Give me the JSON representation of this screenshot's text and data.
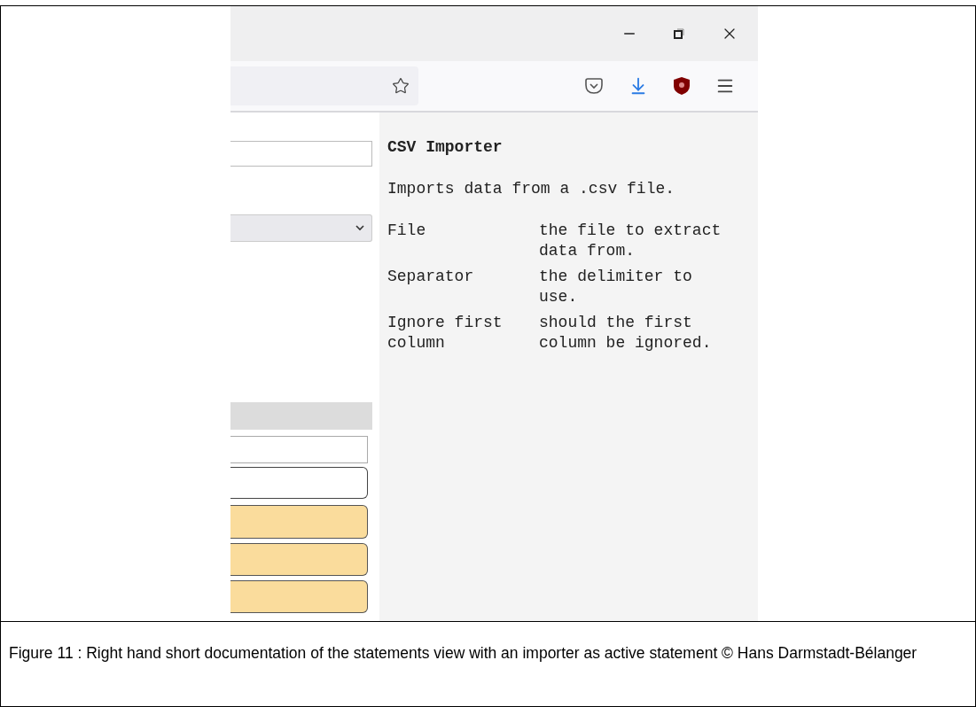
{
  "documentation": {
    "title": "CSV Importer",
    "description": "Imports data from a .csv file.",
    "parameters": [
      {
        "name": "File",
        "description": "the file to extract data from."
      },
      {
        "name": "Separator",
        "description": "the delimiter to use."
      },
      {
        "name": "Ignore first column",
        "description": "should the first column be ignored."
      }
    ]
  },
  "caption": "Figure 11 : Right hand short documentation of the statements view with an importer as active statement © Hans Darmstadt-Bélanger"
}
